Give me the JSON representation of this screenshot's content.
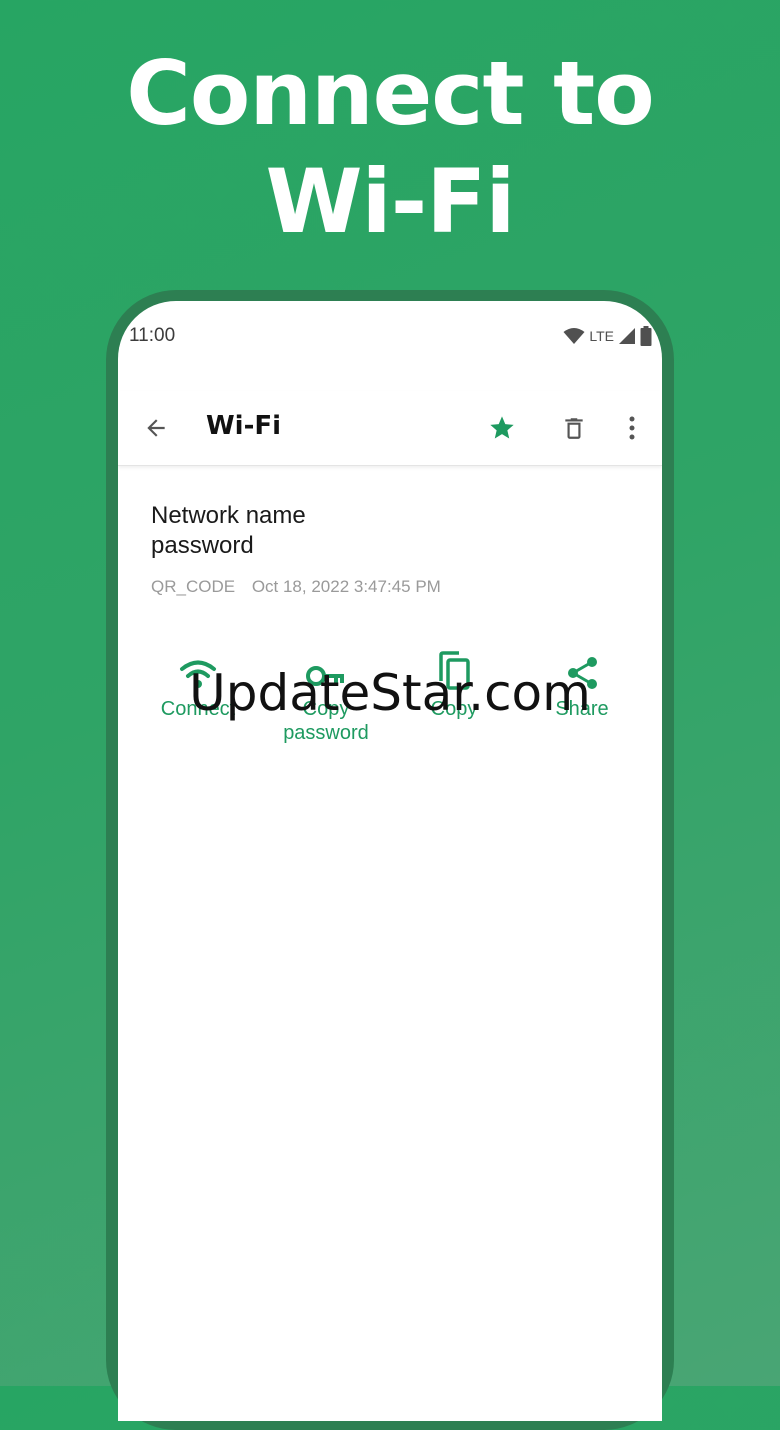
{
  "headline": {
    "line1": "Connect to",
    "line2": "Wi-Fi"
  },
  "status_bar": {
    "time": "11:00",
    "network": "LTE",
    "icons": [
      "wifi-icon",
      "signal-icon",
      "battery-icon"
    ]
  },
  "app_bar": {
    "title": "Wi-Fi",
    "icons": [
      "back-arrow-icon",
      "star-icon",
      "delete-icon",
      "more-vert-icon"
    ]
  },
  "content": {
    "line1": "Network name",
    "line2": "password",
    "format": "QR_CODE",
    "timestamp": "Oct 18, 2022 3:47:45 PM"
  },
  "actions": [
    {
      "label": "Connect",
      "icon": "wifi-icon"
    },
    {
      "label": "Copy password",
      "icon": "key-icon"
    },
    {
      "label": "Copy",
      "icon": "copy-icon"
    },
    {
      "label": "Share",
      "icon": "share-icon"
    }
  ],
  "watermark": "UpdateStar.com",
  "colors": {
    "background": "#2fa466",
    "accent": "#1e9a60",
    "phone_frame": "#2d7f52"
  }
}
